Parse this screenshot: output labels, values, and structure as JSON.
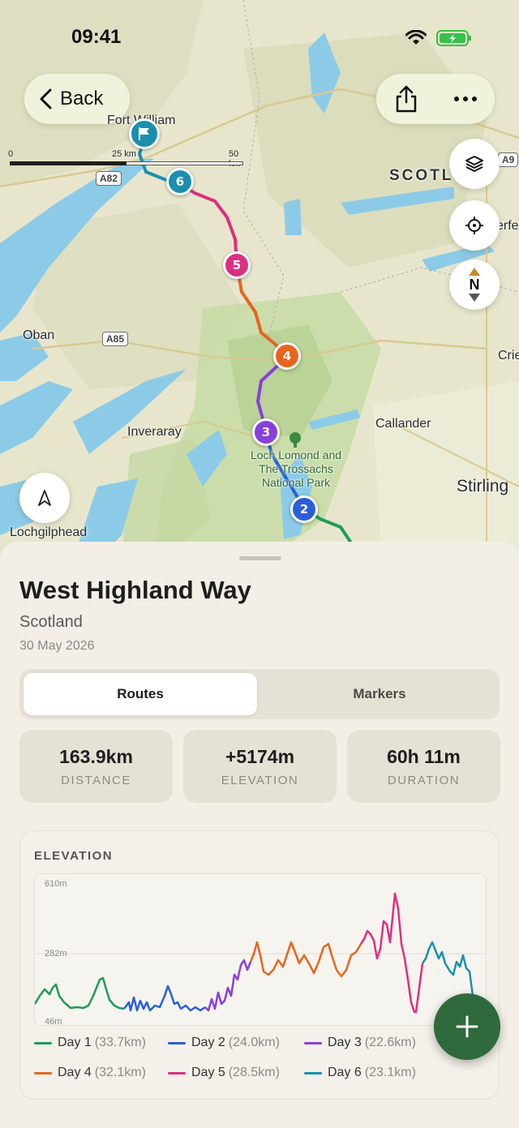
{
  "status": {
    "time": "09:41"
  },
  "nav": {
    "back_label": "Back"
  },
  "map": {
    "scale": {
      "t0": "0",
      "t1": "25 km",
      "t2": "50 km"
    },
    "places": {
      "fort_william": "Fort William",
      "oban": "Oban",
      "inveraray": "Inveraray",
      "callander": "Callander",
      "stirling": "Stirling",
      "lochgilphead": "Lochgilphead",
      "scotland": "SCOTL",
      "crieff": "Crie",
      "perth_frag": "erfe"
    },
    "shields": {
      "a82": "A82",
      "a85": "A85",
      "a9": "A9"
    },
    "park": {
      "line1": "Loch Lomond and",
      "line2": "The Trossachs",
      "line3": "National Park"
    },
    "compass": {
      "label": "N"
    },
    "markers": [
      "2",
      "3",
      "4",
      "5",
      "6"
    ],
    "colors": {
      "day1": "#1f9a5b",
      "day2": "#2b5fd9",
      "day3": "#8a3fdc",
      "day4": "#e8641e",
      "day5": "#dd2f7f",
      "day6": "#1a8fb0"
    }
  },
  "sheet": {
    "title": "West Highland Way",
    "region": "Scotland",
    "date": "30 May 2026",
    "tabs": {
      "routes": "Routes",
      "markers": "Markers"
    },
    "stats": [
      {
        "value": "163.9km",
        "label": "DISTANCE"
      },
      {
        "value": "+5174m",
        "label": "ELEVATION"
      },
      {
        "value": "60h 11m",
        "label": "DURATION"
      }
    ],
    "elevation": {
      "title": "ELEVATION",
      "ticks": {
        "top": "610m",
        "mid": "282m",
        "bottom": "46m"
      }
    },
    "legend": [
      {
        "name": "Day 1",
        "km": "(33.7km)",
        "color": "#1f9a5b"
      },
      {
        "name": "Day 2",
        "km": "(24.0km)",
        "color": "#2b5fd9"
      },
      {
        "name": "Day 3",
        "km": "(22.6km)",
        "color": "#8a3fdc"
      },
      {
        "name": "Day 4",
        "km": "(32.1km)",
        "color": "#e8641e"
      },
      {
        "name": "Day 5",
        "km": "(28.5km)",
        "color": "#dd2f7f"
      },
      {
        "name": "Day 6",
        "km": "(23.1km)",
        "color": "#1a8fb0"
      }
    ]
  }
}
